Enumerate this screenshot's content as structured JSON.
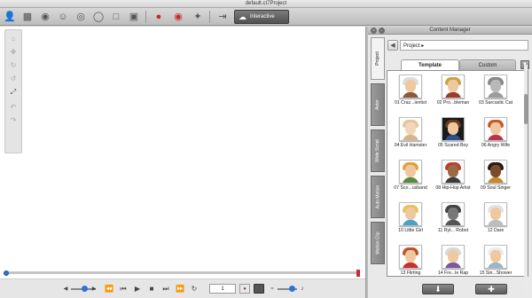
{
  "window": {
    "title": "default.ct7Project"
  },
  "toolbar": {
    "interactive_label": "Interactive",
    "icons": [
      "actor-icon",
      "scene-icon",
      "head-icon",
      "eye-icon",
      "mouth-icon",
      "lips-icon",
      "frame-icon",
      "image-icon",
      "puppet-record-icon",
      "record-icon",
      "motion-icon",
      "export-icon"
    ]
  },
  "stage_tools": [
    "move-icon",
    "pan-icon",
    "rotate-icon",
    "rotate-ccw-icon",
    "fit-icon",
    "undo-icon",
    "redo-icon"
  ],
  "playback": {
    "frame": "1"
  },
  "content_manager": {
    "title": "Content Manager",
    "side_tabs": [
      "Project",
      "Actor",
      "Wide Script",
      "Auto Motion",
      "Motion Clip"
    ],
    "path": "Project ▸",
    "tabs": [
      "Template",
      "Custom"
    ],
    "items": [
      {
        "label": "01 Craz...ientist"
      },
      {
        "label": "02 Pro...bleman"
      },
      {
        "label": "03 Sarcastic Cat"
      },
      {
        "label": "04 Evil Hamster"
      },
      {
        "label": "05 Scared Boy"
      },
      {
        "label": "06 Angry Wife"
      },
      {
        "label": "07 Sco...usband"
      },
      {
        "label": "08 Hip-Hop Artist"
      },
      {
        "label": "09 Soul Singer"
      },
      {
        "label": "10 Little Girl"
      },
      {
        "label": "11 Ryt... Robot"
      },
      {
        "label": "12 Dare"
      },
      {
        "label": "13 Flirting"
      },
      {
        "label": "14 Fre...le Rap"
      },
      {
        "label": "15 Sin...Shower"
      }
    ]
  },
  "colors": {
    "accent": "#2f72d6",
    "record": "#cc2b2b"
  }
}
